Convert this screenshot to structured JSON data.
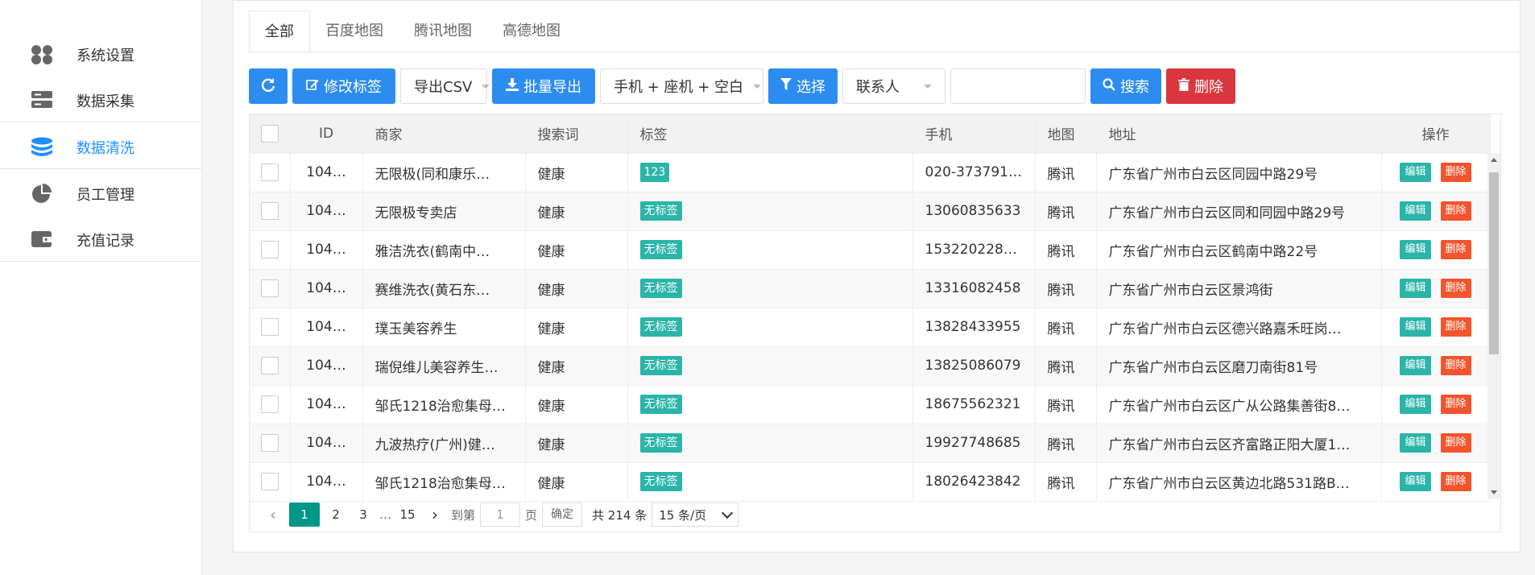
{
  "sidebar": {
    "items": [
      {
        "label": "系统设置",
        "icon": "grid-icon"
      },
      {
        "label": "数据采集",
        "icon": "server-icon"
      },
      {
        "label": "数据清洗",
        "icon": "database-icon",
        "active": true
      },
      {
        "label": "员工管理",
        "icon": "pie-chart-icon"
      },
      {
        "label": "充值记录",
        "icon": "wallet-icon"
      }
    ]
  },
  "tabs": [
    "全部",
    "百度地图",
    "腾讯地图",
    "高德地图"
  ],
  "toolbar": {
    "edit_tags": "修改标签",
    "export_csv": "导出CSV",
    "batch_export": "批量导出",
    "phone_filter": "手机 + 座机 + 空白",
    "select": "选择",
    "contact": "联系人",
    "search_value": "",
    "search": "搜索",
    "delete": "删除"
  },
  "table": {
    "headers": [
      "ID",
      "商家",
      "搜索词",
      "标签",
      "手机",
      "地图",
      "地址",
      "操作"
    ],
    "rows": [
      {
        "id": "104…",
        "merchant": "无限极(同和康乐…",
        "keyword": "健康",
        "tag": "123",
        "phone": "020-373791…",
        "map": "腾讯",
        "address": "广东省广州市白云区同园中路29号"
      },
      {
        "id": "104…",
        "merchant": "无限极专卖店",
        "keyword": "健康",
        "tag": "无标签",
        "phone": "13060835633",
        "map": "腾讯",
        "address": "广东省广州市白云区同和同园中路29号"
      },
      {
        "id": "104…",
        "merchant": "雅洁洗衣(鹤南中…",
        "keyword": "健康",
        "tag": "无标签",
        "phone": "153220228…",
        "map": "腾讯",
        "address": "广东省广州市白云区鹤南中路22号"
      },
      {
        "id": "104…",
        "merchant": "赛维洗衣(黄石东…",
        "keyword": "健康",
        "tag": "无标签",
        "phone": "13316082458",
        "map": "腾讯",
        "address": "广东省广州市白云区景鸿街"
      },
      {
        "id": "104…",
        "merchant": "璞玉美容养生",
        "keyword": "健康",
        "tag": "无标签",
        "phone": "13828433955",
        "map": "腾讯",
        "address": "广东省广州市白云区德兴路嘉禾旺岗…"
      },
      {
        "id": "104…",
        "merchant": "瑞倪维儿美容养生…",
        "keyword": "健康",
        "tag": "无标签",
        "phone": "13825086079",
        "map": "腾讯",
        "address": "广东省广州市白云区磨刀南街81号"
      },
      {
        "id": "104…",
        "merchant": "邹氏1218治愈集母…",
        "keyword": "健康",
        "tag": "无标签",
        "phone": "18675562321",
        "map": "腾讯",
        "address": "广东省广州市白云区广从公路集善街8…"
      },
      {
        "id": "104…",
        "merchant": "九波热疗(广州)健…",
        "keyword": "健康",
        "tag": "无标签",
        "phone": "19927748685",
        "map": "腾讯",
        "address": "广东省广州市白云区齐富路正阳大厦1…"
      },
      {
        "id": "104…",
        "merchant": "邹氏1218治愈集母…",
        "keyword": "健康",
        "tag": "无标签",
        "phone": "18026423842",
        "map": "腾讯",
        "address": "广东省广州市白云区黄边北路531路B…"
      }
    ],
    "op_edit": "编辑",
    "op_delete": "删除"
  },
  "pager": {
    "pages": [
      "1",
      "2",
      "3"
    ],
    "ellipsis": "…",
    "last": "15",
    "goto_prefix": "到第",
    "goto_value": "1",
    "goto_suffix": "页",
    "confirm": "确定",
    "total": "共 214 条",
    "page_size": "15 条/页"
  },
  "colors": {
    "primary": "#2d8cf0",
    "danger": "#d9363e",
    "tag": "#2bb5a9",
    "active_menu": "#1e90ff",
    "pager_current": "#009688"
  }
}
